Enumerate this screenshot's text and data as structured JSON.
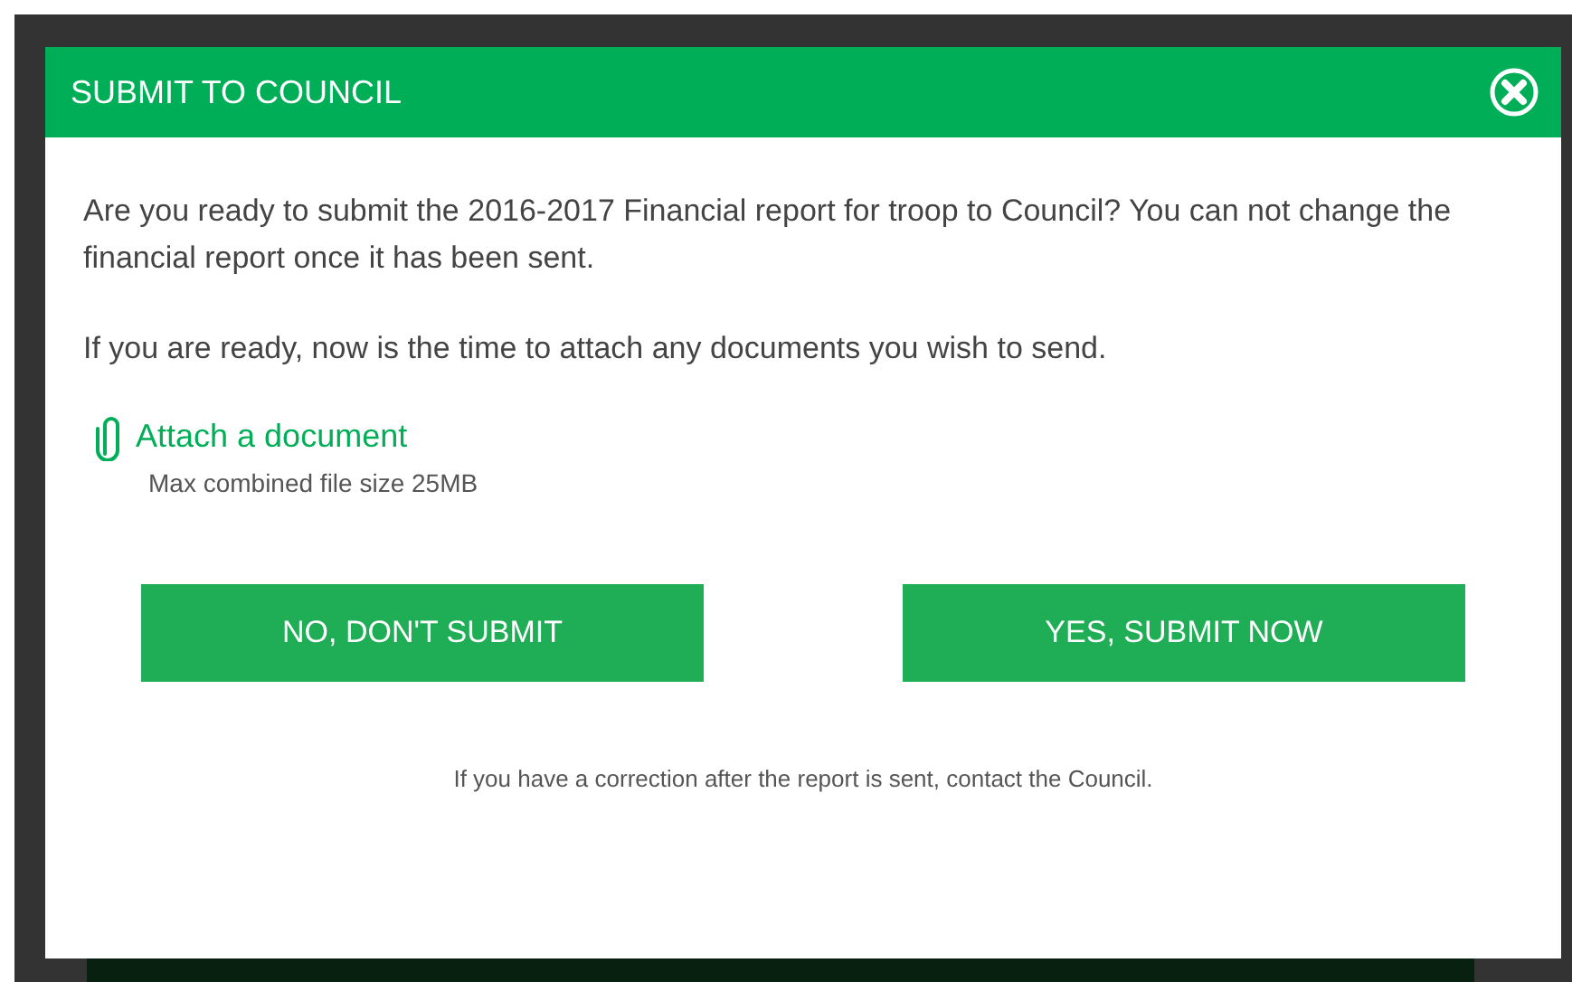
{
  "dialog": {
    "title": "SUBMIT TO COUNCIL",
    "paragraphs": [
      "Are you ready to submit the 2016-2017 Financial report for troop to Council? You can not change the financial report once it has been sent.",
      "If you are ready, now is the time to attach any documents you wish to send."
    ],
    "attach_link": "Attach a document",
    "size_note": "Max combined file size 25MB",
    "buttons": [
      "NO, DON'T SUBMIT",
      "YES, SUBMIT NOW"
    ],
    "footer_note": "If you have a correction after the report is sent, contact the Council."
  }
}
